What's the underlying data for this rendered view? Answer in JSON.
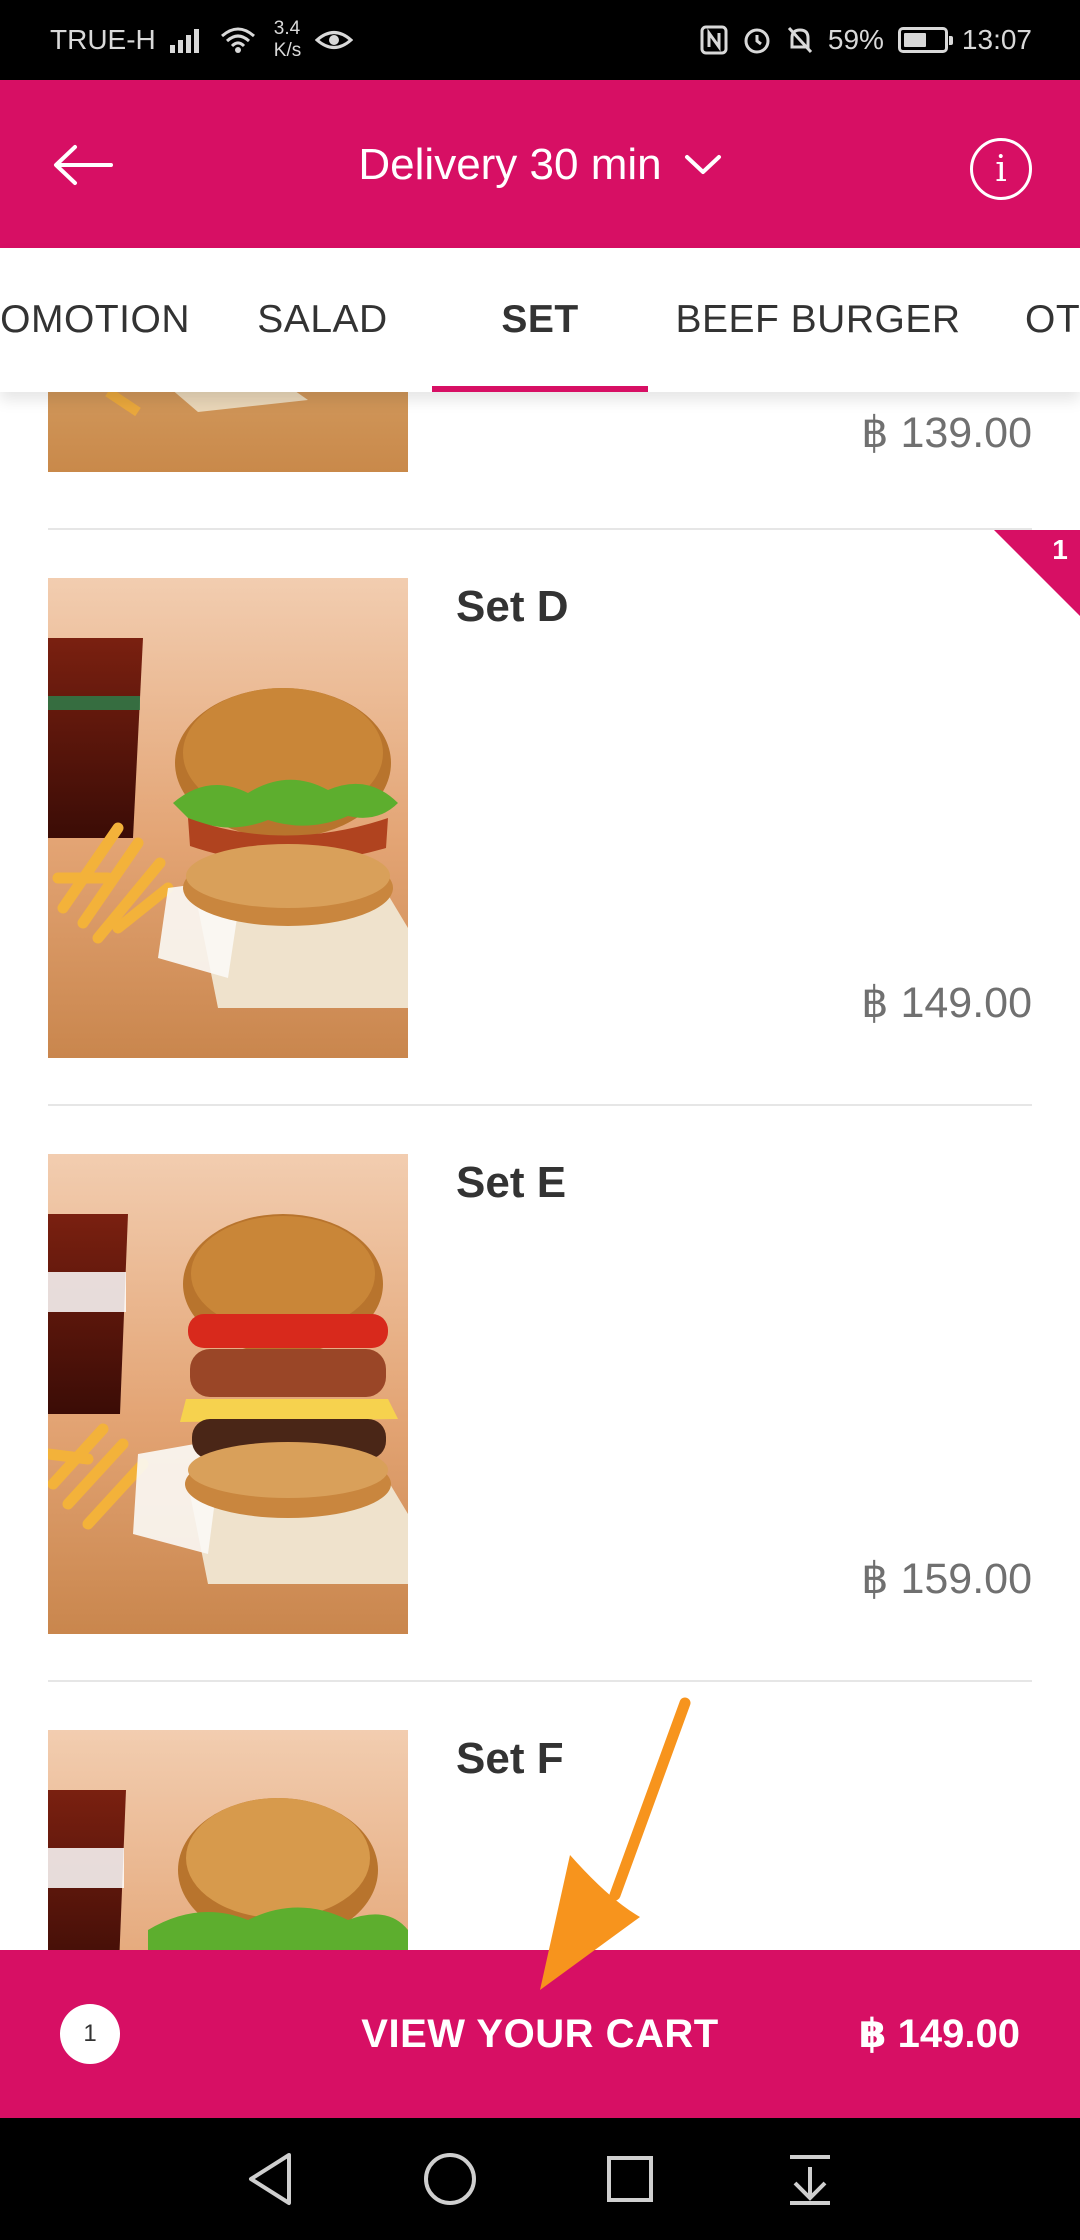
{
  "status_bar": {
    "carrier": "TRUE-H",
    "speed_value": "3.4",
    "speed_unit": "K/s",
    "battery": "59%",
    "battery_level": 0.59,
    "time": "13:07"
  },
  "header": {
    "title": "Delivery 30 min"
  },
  "tabs": [
    {
      "label": "PROMOTION"
    },
    {
      "label": "SALAD"
    },
    {
      "label": "SET"
    },
    {
      "label": "BEEF BURGER"
    },
    {
      "label": "OTHERS"
    }
  ],
  "active_tab": "SET",
  "items": [
    {
      "name": "",
      "price": "฿ 139.00"
    },
    {
      "name": "Set D",
      "price": "฿ 149.00",
      "quantity_badge": "1"
    },
    {
      "name": "Set E",
      "price": "฿ 159.00"
    },
    {
      "name": "Set F",
      "price": ""
    }
  ],
  "cart": {
    "count": "1",
    "label": "VIEW YOUR CART",
    "total": "฿ 149.00"
  },
  "colors": {
    "brand": "#d70f64",
    "annotation_arrow": "#f7941d"
  }
}
